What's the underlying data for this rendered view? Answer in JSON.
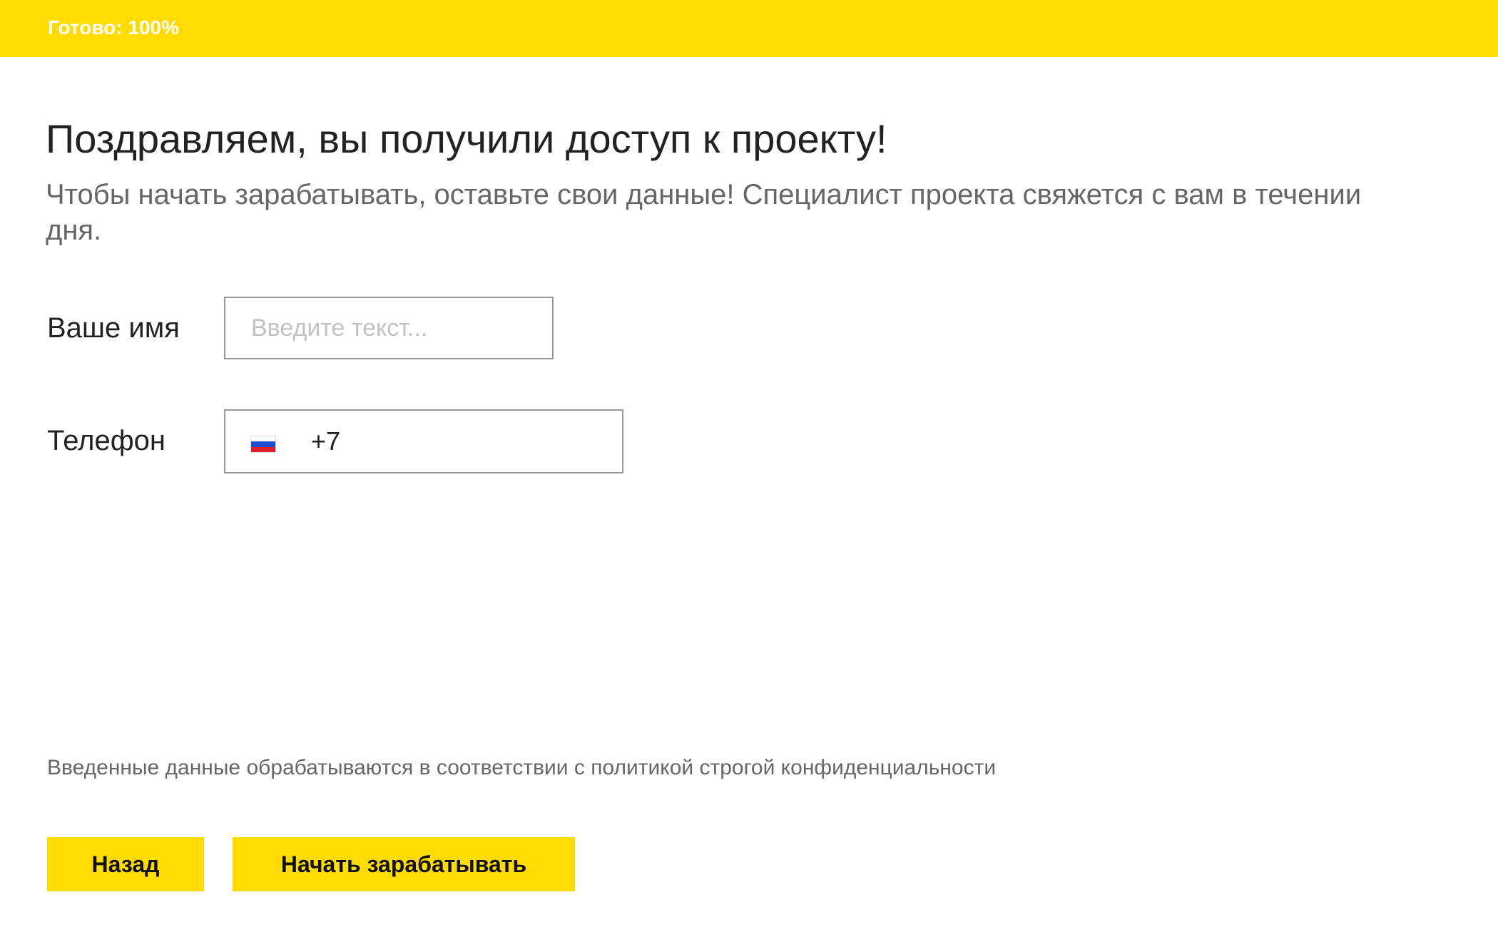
{
  "progress": {
    "label": "Готово: 100%",
    "value": 1.0,
    "color": "#FFDB00"
  },
  "header": {
    "title": "Поздравляем, вы получили доступ к проекту!",
    "subtitle": "Чтобы начать зарабатывать, оставьте свои данные! Специалист проекта свяжется с вам в течении дня."
  },
  "form": {
    "name_label": "Ваше имя",
    "name_placeholder": "Введите текст...",
    "name_value": "",
    "phone_label": "Телефон",
    "phone_value": "+7",
    "phone_flag_icon": "russia-flag-icon"
  },
  "footer": {
    "privacy_text": "Введенные данные обрабатываются в соответствии с политикой строгой конфиденциальности",
    "back_label": "Назад",
    "start_label": "Начать зарабатывать"
  }
}
